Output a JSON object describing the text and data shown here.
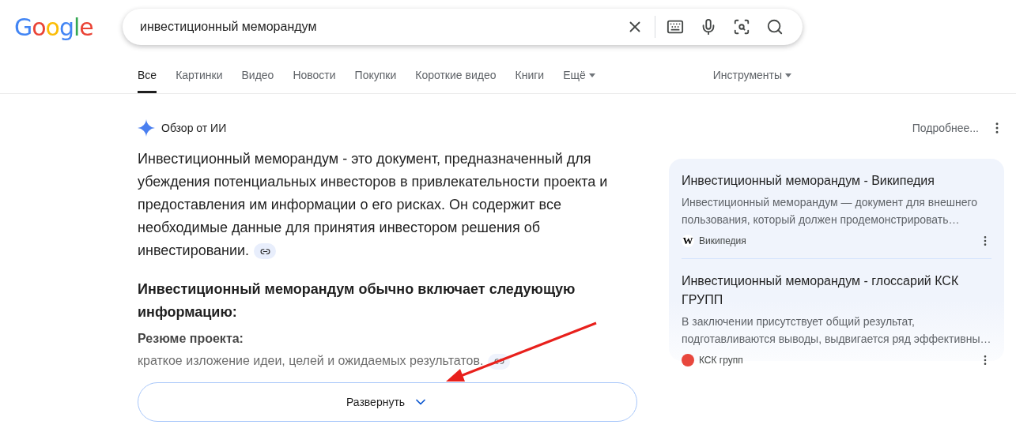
{
  "logo": "Google",
  "search": {
    "value": "инвестиционный меморандум"
  },
  "tabs": [
    {
      "label": "Все",
      "selected": true,
      "kind": "tab"
    },
    {
      "label": "Картинки",
      "selected": false,
      "kind": "tab"
    },
    {
      "label": "Видео",
      "selected": false,
      "kind": "tab"
    },
    {
      "label": "Новости",
      "selected": false,
      "kind": "tab"
    },
    {
      "label": "Покупки",
      "selected": false,
      "kind": "tab"
    },
    {
      "label": "Короткие видео",
      "selected": false,
      "kind": "tab"
    },
    {
      "label": "Книги",
      "selected": false,
      "kind": "tab"
    },
    {
      "label": "Ещё",
      "selected": false,
      "kind": "menu"
    }
  ],
  "tools": "Инструменты",
  "overview": {
    "title": "Обзор от ИИ",
    "more": "Подробнее...",
    "paragraph": "Инвестиционный меморандум - это документ, предназначенный для убеждения потенциальных инвесторов в привлекательности проекта и предоставления им информации о его рисках. Он содержит все необходимые данные для принятия инвестором решения об инвестировании.",
    "heading": "Инвестиционный меморандум обычно включает следующую информацию:",
    "items": [
      {
        "title": "Резюме проекта:",
        "text": "краткое изложение идеи, целей и ожидаемых результатов."
      }
    ],
    "expand": "Развернуть"
  },
  "sources": [
    {
      "title": "Инвестиционный меморандум - Википедия",
      "snippet": "Инвестиционный меморандум — документ для внешнего пользования, который должен продемонстрировать…",
      "site": "Википедия",
      "site_letter": "W",
      "color": "#ffffff"
    },
    {
      "title": "Инвестиционный меморандум - глоссарий КСК ГРУПП",
      "snippet": "В заключении присутствует общий результат, подготавливаются выводы, выдвигается ряд эффективны…",
      "site": "КСК групп",
      "color": "#e8473d"
    }
  ]
}
